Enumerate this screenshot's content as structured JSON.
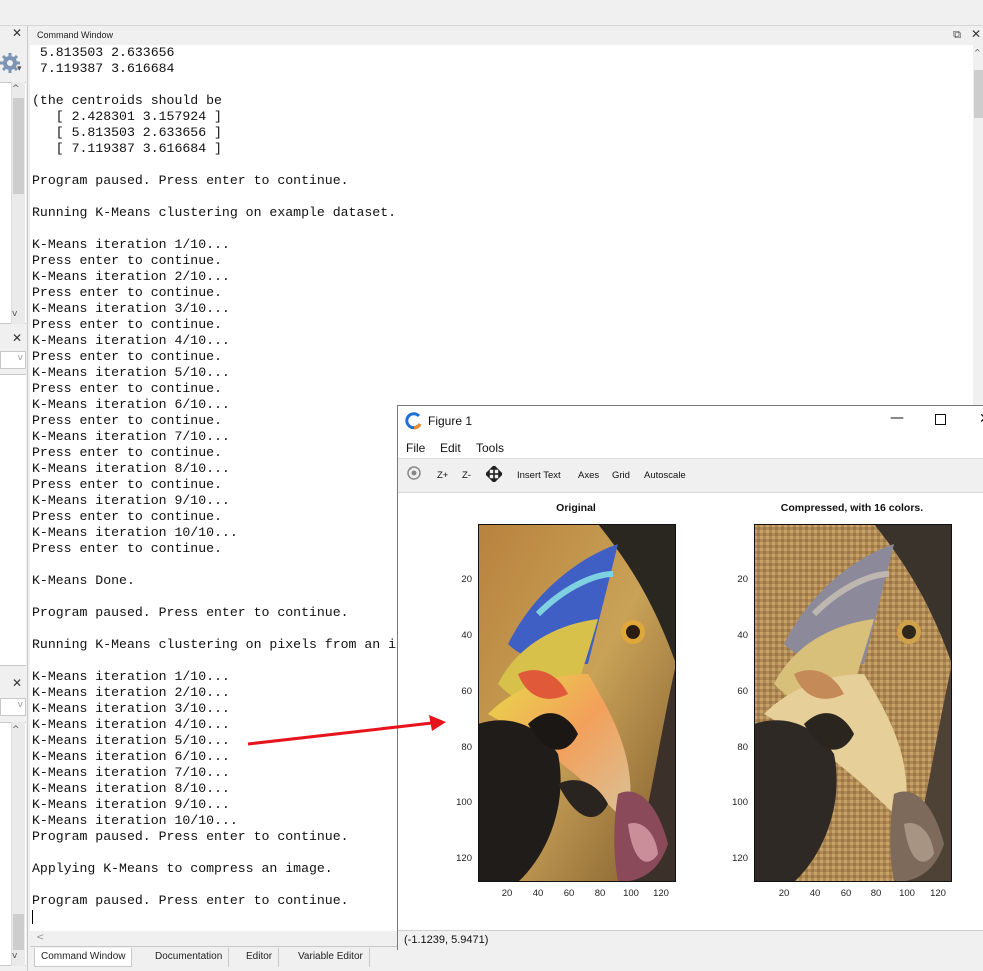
{
  "command_window": {
    "title": "Command Window",
    "lines": [
      " 5.813503 2.633656",
      " 7.119387 3.616684",
      "",
      "(the centroids should be",
      "   [ 2.428301 3.157924 ]",
      "   [ 5.813503 2.633656 ]",
      "   [ 7.119387 3.616684 ]",
      "",
      "Program paused. Press enter to continue.",
      "",
      "Running K-Means clustering on example dataset.",
      "",
      "K-Means iteration 1/10...",
      "Press enter to continue.",
      "K-Means iteration 2/10...",
      "Press enter to continue.",
      "K-Means iteration 3/10...",
      "Press enter to continue.",
      "K-Means iteration 4/10...",
      "Press enter to continue.",
      "K-Means iteration 5/10...",
      "Press enter to continue.",
      "K-Means iteration 6/10...",
      "Press enter to continue.",
      "K-Means iteration 7/10...",
      "Press enter to continue.",
      "K-Means iteration 8/10...",
      "Press enter to continue.",
      "K-Means iteration 9/10...",
      "Press enter to continue.",
      "K-Means iteration 10/10...",
      "Press enter to continue.",
      "",
      "K-Means Done.",
      "",
      "Program paused. Press enter to continue.",
      "",
      "Running K-Means clustering on pixels from an i",
      "",
      "K-Means iteration 1/10...",
      "K-Means iteration 2/10...",
      "K-Means iteration 3/10...",
      "K-Means iteration 4/10...",
      "K-Means iteration 5/10...",
      "K-Means iteration 6/10...",
      "K-Means iteration 7/10...",
      "K-Means iteration 8/10...",
      "K-Means iteration 9/10...",
      "K-Means iteration 10/10...",
      "Program paused. Press enter to continue.",
      "",
      "Applying K-Means to compress an image.",
      "",
      "Program paused. Press enter to continue."
    ]
  },
  "tabs": [
    {
      "label": "Command Window",
      "active": true
    },
    {
      "label": "Documentation",
      "active": false
    },
    {
      "label": "Editor",
      "active": false
    },
    {
      "label": "Variable Editor",
      "active": false
    }
  ],
  "figure": {
    "title": "Figure 1",
    "menu": [
      "File",
      "Edit",
      "Tools"
    ],
    "toolbar": [
      "Z+",
      "Z-",
      "Insert Text",
      "Axes",
      "Grid",
      "Autoscale"
    ],
    "status": "(-1.1239, 5.9471)",
    "axes": [
      {
        "title": "Original",
        "yticks": [
          "20",
          "40",
          "60",
          "80",
          "100",
          "120"
        ],
        "xticks": [
          "20",
          "40",
          "60",
          "80",
          "100",
          "120"
        ]
      },
      {
        "title": "Compressed, with 16 colors.",
        "yticks": [
          "20",
          "40",
          "60",
          "80",
          "100",
          "120"
        ],
        "xticks": [
          "20",
          "40",
          "60",
          "80",
          "100",
          "120"
        ]
      }
    ]
  },
  "colors": {
    "arrow": "#e8141b",
    "window_bg": "#f0f0f0",
    "octave_blue": "#1e6fd9",
    "octave_orange": "#f08a24"
  }
}
